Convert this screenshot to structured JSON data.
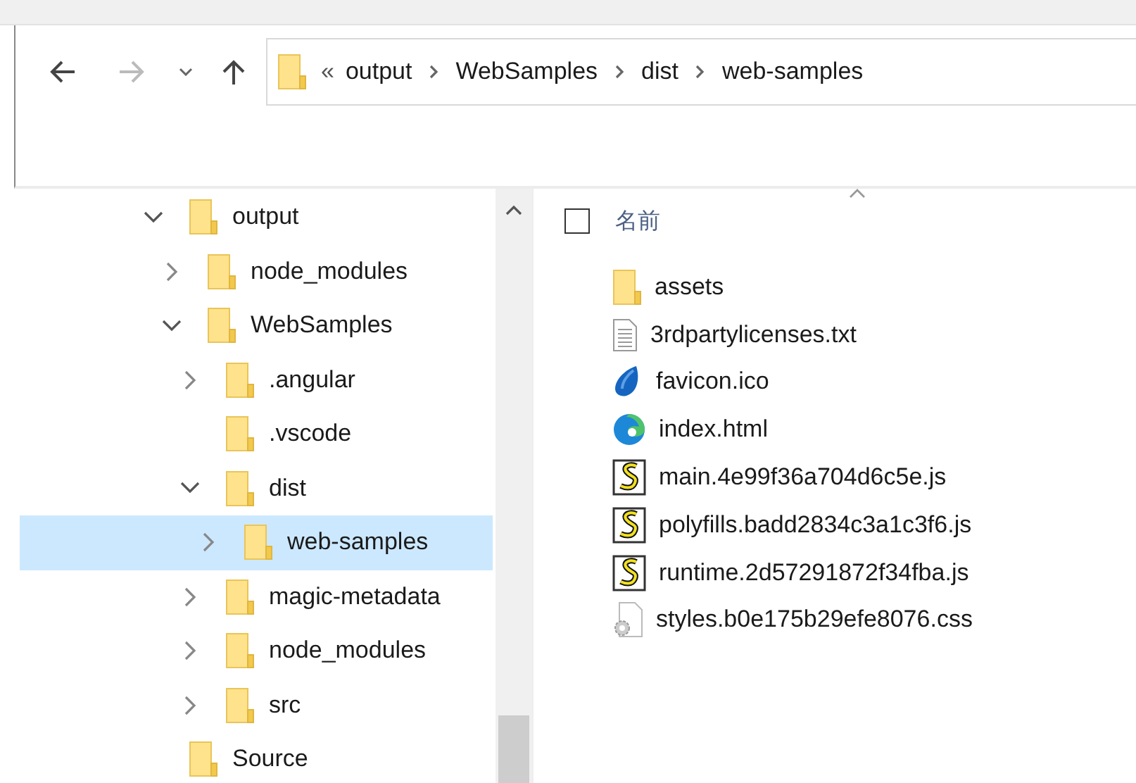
{
  "navigation": {
    "breadcrumb_overflow": "«",
    "path": [
      "output",
      "WebSamples",
      "dist",
      "web-samples"
    ]
  },
  "tree": [
    {
      "label": "output",
      "expandable": true,
      "expanded": true,
      "selected": false,
      "children": [
        {
          "label": "node_modules",
          "expandable": true,
          "expanded": false,
          "selected": false
        },
        {
          "label": "WebSamples",
          "expandable": true,
          "expanded": true,
          "selected": false,
          "children": [
            {
              "label": ".angular",
              "expandable": true,
              "expanded": false,
              "selected": false
            },
            {
              "label": ".vscode",
              "expandable": false,
              "selected": false
            },
            {
              "label": "dist",
              "expandable": true,
              "expanded": true,
              "selected": false,
              "children": [
                {
                  "label": "web-samples",
                  "expandable": true,
                  "expanded": false,
                  "selected": true
                }
              ]
            },
            {
              "label": "magic-metadata",
              "expandable": true,
              "expanded": false,
              "selected": false
            },
            {
              "label": "node_modules",
              "expandable": true,
              "expanded": false,
              "selected": false
            },
            {
              "label": "src",
              "expandable": true,
              "expanded": false,
              "selected": false
            }
          ]
        }
      ]
    },
    {
      "label": "Source",
      "expandable": false,
      "selected": false
    }
  ],
  "file_list": {
    "columns": [
      {
        "label": "名前",
        "sorted": true
      }
    ],
    "select_all": {
      "checked": false
    },
    "files": [
      {
        "name": "assets",
        "kind": "folder"
      },
      {
        "name": "3rdpartylicenses.txt",
        "kind": "text"
      },
      {
        "name": "favicon.ico",
        "kind": "icon"
      },
      {
        "name": "index.html",
        "kind": "html"
      },
      {
        "name": "main.4e99f36a704d6c5e.js",
        "kind": "script"
      },
      {
        "name": "polyfills.badd2834c3a1c3f6.js",
        "kind": "script"
      },
      {
        "name": "runtime.2d57291872f34fba.js",
        "kind": "script"
      },
      {
        "name": "styles.b0e175b29efe8076.css",
        "kind": "stylesheet"
      }
    ]
  }
}
